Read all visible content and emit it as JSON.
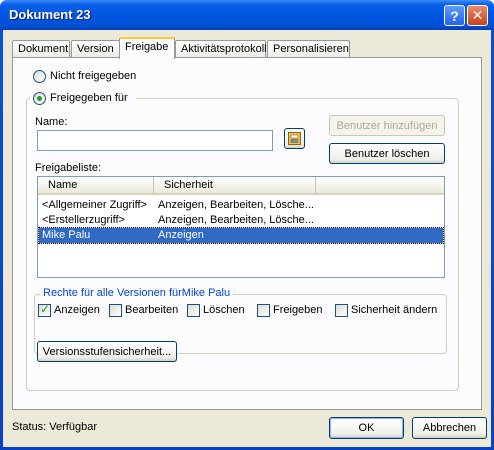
{
  "window": {
    "title": "Dokument 23",
    "help_glyph": "?",
    "close_glyph": "✕"
  },
  "tabs": [
    {
      "label": "Dokument"
    },
    {
      "label": "Version"
    },
    {
      "label": "Freigabe",
      "active": true
    },
    {
      "label": "Aktivitätsprotokoll"
    },
    {
      "label": "Personalisieren"
    }
  ],
  "sharing": {
    "not_shared_label": "Nicht freigegeben",
    "shared_for_label": "Freigegeben für",
    "selected_option": "shared_for",
    "name_label": "Name:",
    "name_value": "",
    "add_user_label": "Benutzer hinzufügen",
    "delete_user_label": "Benutzer löschen",
    "share_list_label": "Freigabeliste:",
    "columns": [
      "Name",
      "Sicherheit"
    ],
    "rows": [
      {
        "name": "<Allgemeiner Zugriff>",
        "security": "Anzeigen, Bearbeiten, Lösche..."
      },
      {
        "name": "<Erstellerzugriff>",
        "security": "Anzeigen, Bearbeiten, Lösche..."
      },
      {
        "name": "Mike Palu",
        "security": "Anzeigen",
        "selected": true
      }
    ]
  },
  "rights": {
    "title": "Rechte für alle Versionen fürMike Palu",
    "items": [
      {
        "label": "Anzeigen",
        "checked": true
      },
      {
        "label": "Bearbeiten",
        "checked": false
      },
      {
        "label": "Löschen",
        "checked": false
      },
      {
        "label": "Freigeben",
        "checked": false
      },
      {
        "label": "Sicherheit ändern",
        "checked": false
      }
    ]
  },
  "version_security_label": "Versionsstufensicherheit...",
  "status_text": "Status: Verfügbar",
  "ok_label": "OK",
  "cancel_label": "Abbrechen",
  "colors": {
    "accent": "#316ac5",
    "title_bar": "#0056e0",
    "dialog_bg": "#ece9d8"
  },
  "icons": {
    "browse": "address-book-icon"
  }
}
